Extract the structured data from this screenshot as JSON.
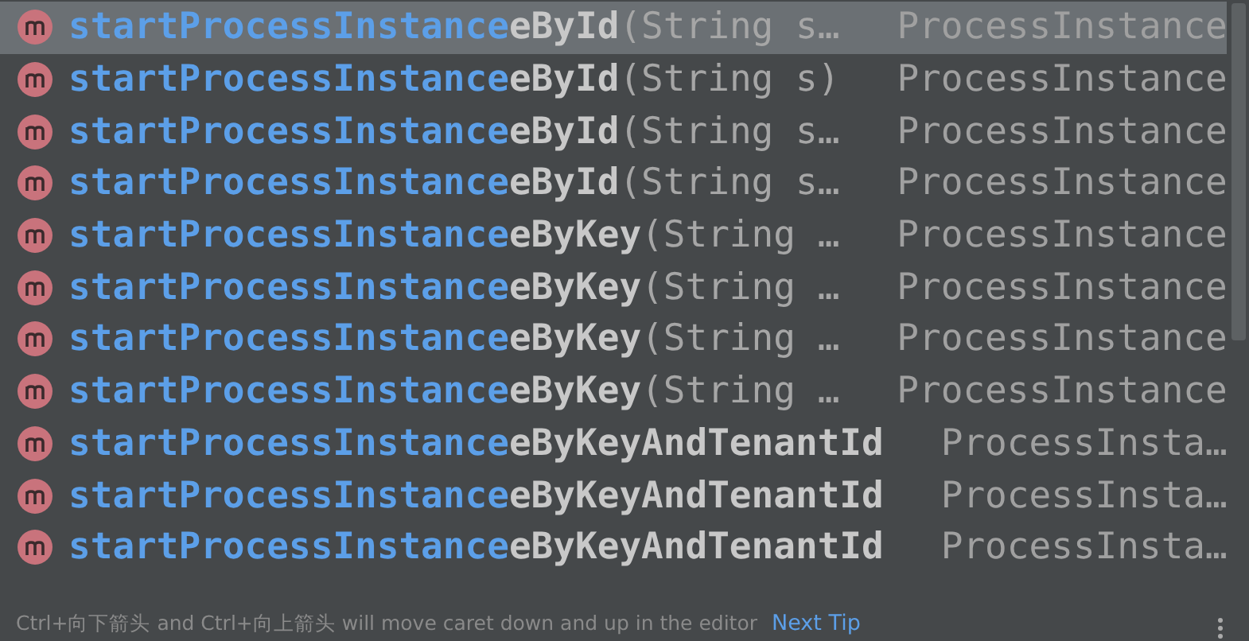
{
  "completions": [
    {
      "match": "startProcessInstance",
      "rest": "eById",
      "params": "(String s…",
      "type": "ProcessInstance",
      "selected": true
    },
    {
      "match": "startProcessInstance",
      "rest": "eById",
      "params": "(String s)",
      "type": "ProcessInstance",
      "selected": false
    },
    {
      "match": "startProcessInstance",
      "rest": "eById",
      "params": "(String s…",
      "type": "ProcessInstance",
      "selected": false
    },
    {
      "match": "startProcessInstance",
      "rest": "eById",
      "params": "(String s…",
      "type": "ProcessInstance",
      "selected": false
    },
    {
      "match": "startProcessInstance",
      "rest": "eByKey",
      "params": "(String …",
      "type": "ProcessInstance",
      "selected": false
    },
    {
      "match": "startProcessInstance",
      "rest": "eByKey",
      "params": "(String …",
      "type": "ProcessInstance",
      "selected": false
    },
    {
      "match": "startProcessInstance",
      "rest": "eByKey",
      "params": "(String …",
      "type": "ProcessInstance",
      "selected": false
    },
    {
      "match": "startProcessInstance",
      "rest": "eByKey",
      "params": "(String …",
      "type": "ProcessInstance",
      "selected": false
    },
    {
      "match": "startProcessInstance",
      "rest": "eByKeyAndTenantId",
      "type": "ProcessInsta…",
      "selected": false
    },
    {
      "match": "startProcessInstance",
      "rest": "eByKeyAndTenantId",
      "type": "ProcessInsta…",
      "selected": false
    },
    {
      "match": "startProcessInstance",
      "rest": "eByKeyAndTenantId",
      "type": "ProcessInsta…",
      "selected": false
    }
  ],
  "footer": {
    "hint": "Ctrl+向下箭头 and Ctrl+向上箭头 will move caret down and up in the editor",
    "link": "Next Tip"
  }
}
